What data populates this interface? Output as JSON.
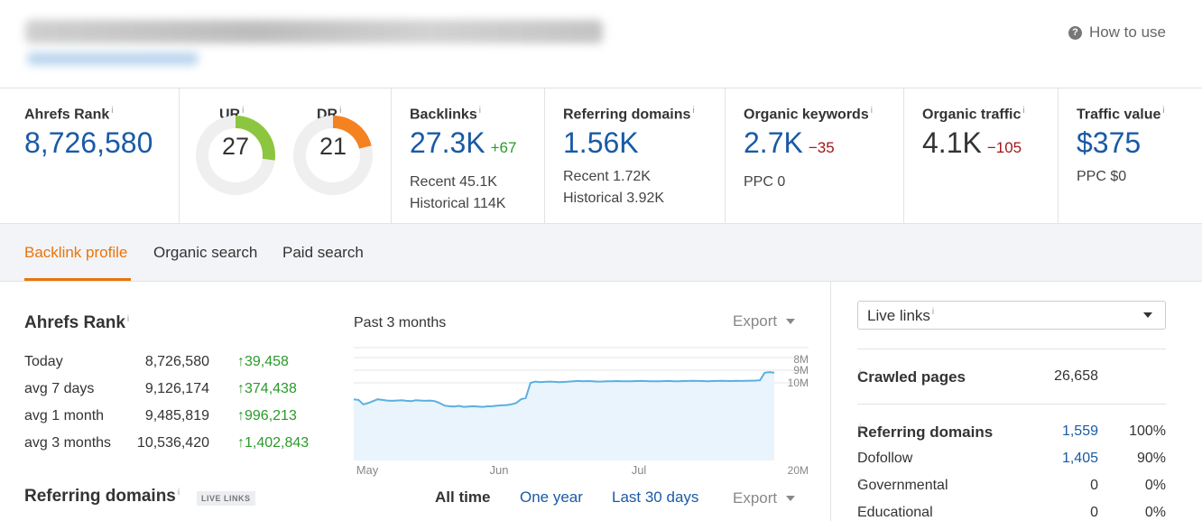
{
  "header": {
    "how_to_use": "How to use",
    "help_icon_glyph": "?"
  },
  "metrics": {
    "ahrefs_rank": {
      "label": "Ahrefs Rank",
      "value": "8,726,580"
    },
    "ur": {
      "label": "UR",
      "value": "27",
      "fraction": 0.27,
      "color": "#8cc63f"
    },
    "dr": {
      "label": "DR",
      "value": "21",
      "fraction": 0.21,
      "color": "#f58220"
    },
    "backlinks": {
      "label": "Backlinks",
      "value": "27.3K",
      "delta": "+67",
      "recent": "Recent 45.1K",
      "historical": "Historical 114K"
    },
    "referring_domains": {
      "label": "Referring domains",
      "value": "1.56K",
      "recent": "Recent 1.72K",
      "historical": "Historical 3.92K"
    },
    "organic_keywords": {
      "label": "Organic keywords",
      "value": "2.7K",
      "delta": "−35",
      "ppc": "PPC 0"
    },
    "organic_traffic": {
      "label": "Organic traffic",
      "value": "4.1K",
      "delta": "−105"
    },
    "traffic_value": {
      "label": "Traffic value",
      "value": "$375",
      "ppc": "PPC $0"
    },
    "info_mark": "i"
  },
  "tabs": [
    {
      "label": "Backlink profile",
      "active": true
    },
    {
      "label": "Organic search",
      "active": false
    },
    {
      "label": "Paid search",
      "active": false
    }
  ],
  "ahrefs_rank_panel": {
    "title": "Ahrefs Rank",
    "rows": [
      {
        "label": "Today",
        "value": "8,726,580",
        "diff": "↑39,458"
      },
      {
        "label": "avg 7 days",
        "value": "9,126,174",
        "diff": "↑374,438"
      },
      {
        "label": "avg 1 month",
        "value": "9,485,819",
        "diff": "↑996,213"
      },
      {
        "label": "avg 3 months",
        "value": "10,536,420",
        "diff": "↑1,402,843"
      }
    ],
    "chart_title": "Past 3 months",
    "export_label": "Export"
  },
  "chart_data": {
    "type": "area",
    "title": "Past 3 months",
    "x_ticks": [
      "May",
      "Jun",
      "Jul"
    ],
    "y_ticks": [
      "8M",
      "9M",
      "10M",
      "20M"
    ],
    "ylim": [
      8000000,
      20000000
    ],
    "y_inverted": true,
    "grid": true,
    "series": [
      {
        "values": [
          10300000,
          10350000,
          10700000,
          10600000,
          10450000,
          10300000,
          10350000,
          10400000,
          10420000,
          10400000,
          10380000,
          10420000,
          10450000,
          10380000,
          10400000,
          10420000,
          10400000,
          10450000,
          10600000,
          10800000,
          10850000,
          10880000,
          10820000,
          10900000,
          10870000,
          10850000,
          10880000,
          10900000,
          10860000,
          10850000,
          10800000,
          10780000,
          10760000,
          10700000,
          10600000,
          10300000,
          10200000,
          9000000,
          8900000,
          8950000,
          8920000,
          8900000,
          8920000,
          8950000,
          8930000,
          8900000,
          8880000,
          8850000,
          8870000,
          8860000,
          8880000,
          8900000,
          8890000,
          8870000,
          8880000,
          8860000,
          8870000,
          8880000,
          8870000,
          8860000,
          8850000,
          8860000,
          8870000,
          8880000,
          8870000,
          8860000,
          8850000,
          8870000,
          8880000,
          8860000,
          8850000,
          8840000,
          8850000,
          8860000,
          8870000,
          8860000,
          8850000,
          8840000,
          8850000,
          8860000,
          8840000,
          8850000,
          8840000,
          8830000,
          8820000,
          8800000,
          8200000,
          8150000,
          8200000
        ]
      }
    ]
  },
  "referring_domains_section": {
    "title": "Referring domains",
    "badge": "LIVE LINKS",
    "ranges": [
      {
        "label": "All time",
        "active": true
      },
      {
        "label": "One year",
        "active": false
      },
      {
        "label": "Last 30 days",
        "active": false
      }
    ],
    "export_label": "Export"
  },
  "right_panel": {
    "select_value": "Live links",
    "crawled_pages": {
      "label": "Crawled pages",
      "value": "26,658"
    },
    "stats": [
      {
        "label": "Referring domains",
        "value": "1,559",
        "pct": "100%",
        "bold": true,
        "link": true
      },
      {
        "label": "Dofollow",
        "value": "1,405",
        "pct": "90%",
        "bold": false,
        "link": true
      },
      {
        "label": "Governmental",
        "value": "0",
        "pct": "0%",
        "bold": false,
        "link": false
      },
      {
        "label": "Educational",
        "value": "0",
        "pct": "0%",
        "bold": false,
        "link": false
      }
    ]
  }
}
